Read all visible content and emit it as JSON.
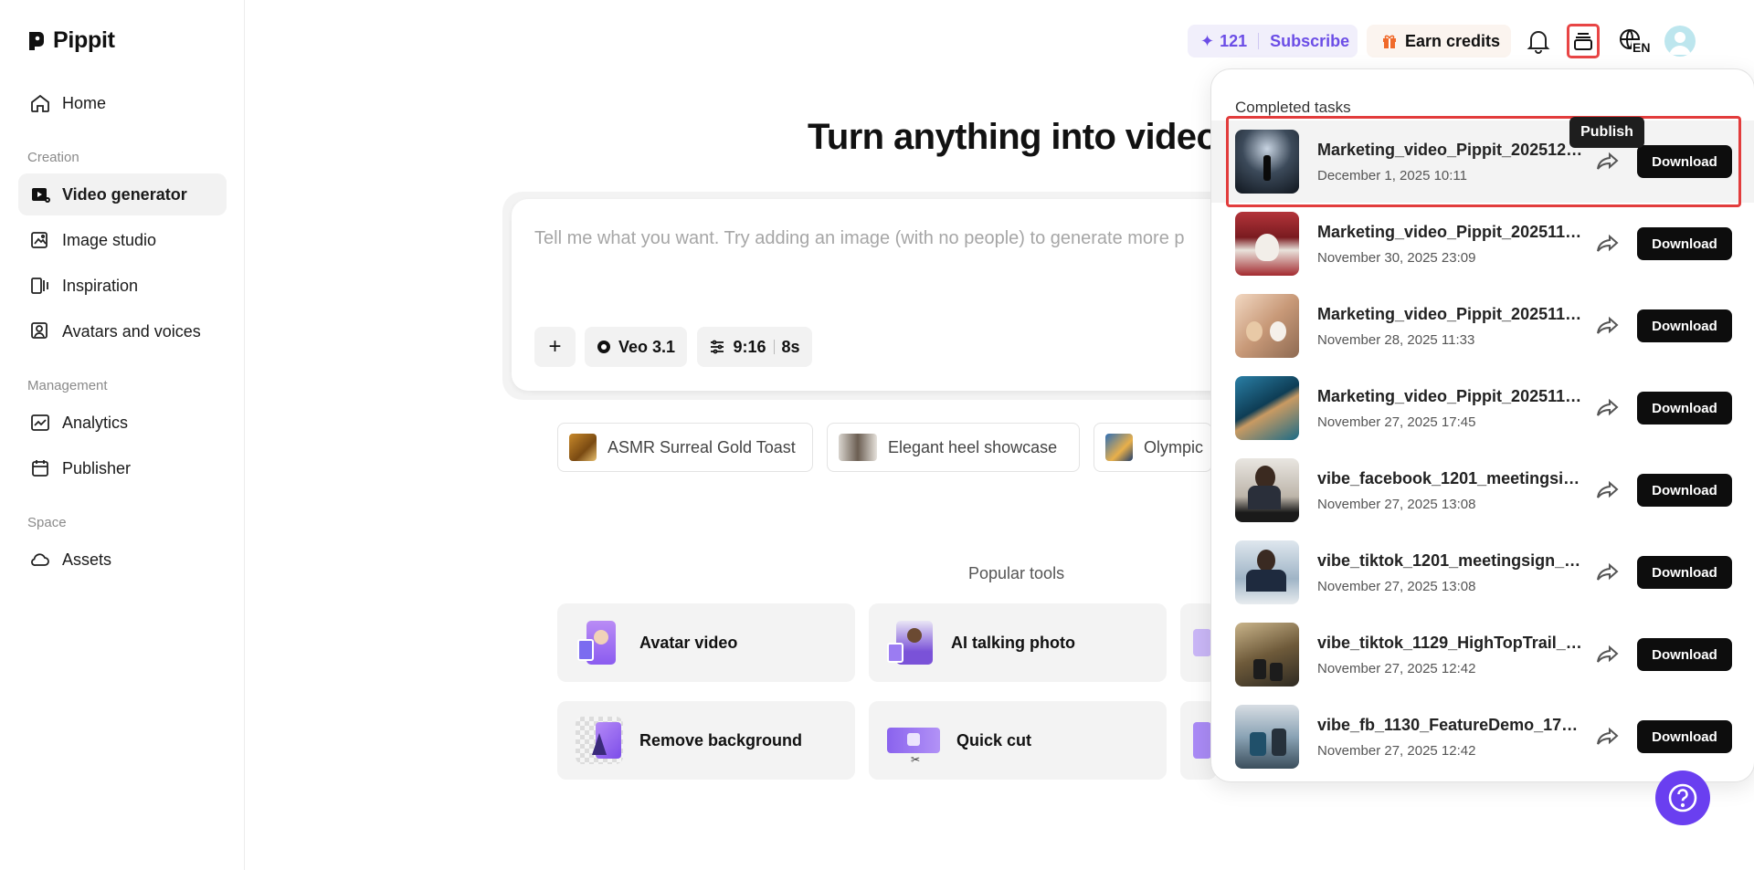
{
  "app": {
    "name": "Pippit"
  },
  "sidebar": {
    "home": "Home",
    "sections": {
      "creation": "Creation",
      "management": "Management",
      "space": "Space"
    },
    "creation_items": [
      "Video generator",
      "Image studio",
      "Inspiration",
      "Avatars and voices"
    ],
    "management_items": [
      "Analytics",
      "Publisher"
    ],
    "space_items": [
      "Assets"
    ]
  },
  "topbar": {
    "credits": "121",
    "subscribe": "Subscribe",
    "earn_credits": "Earn credits",
    "language": "EN"
  },
  "main": {
    "title": "Turn anything into video",
    "prompt_placeholder": "Tell me what you want. Try adding an image (with no people) to generate more p",
    "add_label": "+",
    "model": "Veo 3.1",
    "ratio": "9:16",
    "duration": "8s",
    "suggestions": [
      "ASMR Surreal Gold Toast",
      "Elegant heel showcase",
      "Olympic"
    ],
    "popular_label": "Popular tools",
    "tools": [
      "Avatar video",
      "AI talking photo",
      "Remove background",
      "Quick cut"
    ]
  },
  "tasks_panel": {
    "title": "Completed tasks",
    "tooltip": "Publish",
    "download_label": "Download",
    "tasks": [
      {
        "name": "Marketing_video_Pippit_2025120...",
        "date": "December 1, 2025 10:11"
      },
      {
        "name": "Marketing_video_Pippit_2025113...",
        "date": "November 30, 2025 23:09"
      },
      {
        "name": "Marketing_video_Pippit_2025112...",
        "date": "November 28, 2025 11:33"
      },
      {
        "name": "Marketing_video_Pippit_2025112...",
        "date": "November 27, 2025 17:45"
      },
      {
        "name": "vibe_facebook_1201_meetingsign...",
        "date": "November 27, 2025 13:08"
      },
      {
        "name": "vibe_tiktok_1201_meetingsign_11...",
        "date": "November 27, 2025 13:08"
      },
      {
        "name": "vibe_tiktok_1129_HighTopTrail_171...",
        "date": "November 27, 2025 12:42"
      },
      {
        "name": "vibe_fb_1130_FeatureDemo_1713e...",
        "date": "November 27, 2025 12:42"
      }
    ]
  },
  "colors": {
    "accent": "#6a3ff0",
    "highlight": "#e23c3c",
    "download_bg": "#0d0d0d"
  }
}
